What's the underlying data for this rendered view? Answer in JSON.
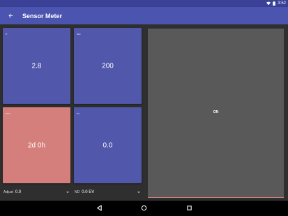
{
  "status_bar": {
    "time": "3:52",
    "icons": [
      "wifi-icon",
      "battery-icon"
    ]
  },
  "app_bar": {
    "title": "Sensor Meter",
    "back_icon": "arrow-back-icon"
  },
  "tiles": [
    {
      "label": "f/",
      "value": "2.8",
      "color": "#5157ab"
    },
    {
      "label": "iso",
      "value": "200",
      "color": "#5157ab"
    },
    {
      "label": "sec",
      "value": "2d 0h",
      "color": "#d47f7c"
    },
    {
      "label": "ev",
      "value": "0.0",
      "color": "#5157ab"
    }
  ],
  "controls": {
    "adjust": {
      "label": "Adjust",
      "value": "0.0"
    },
    "nd": {
      "label": "ND",
      "value": "0.0 EV"
    }
  },
  "panel": {
    "text": "ON",
    "background": "#595959",
    "accent": "#d47f7c"
  },
  "nav_bar": {
    "icons": [
      "nav-back-icon",
      "nav-home-icon",
      "nav-recents-icon"
    ]
  },
  "colors": {
    "primary": "#4b55b0",
    "primary_dark": "#3a4196",
    "accent": "#d47f7c"
  }
}
